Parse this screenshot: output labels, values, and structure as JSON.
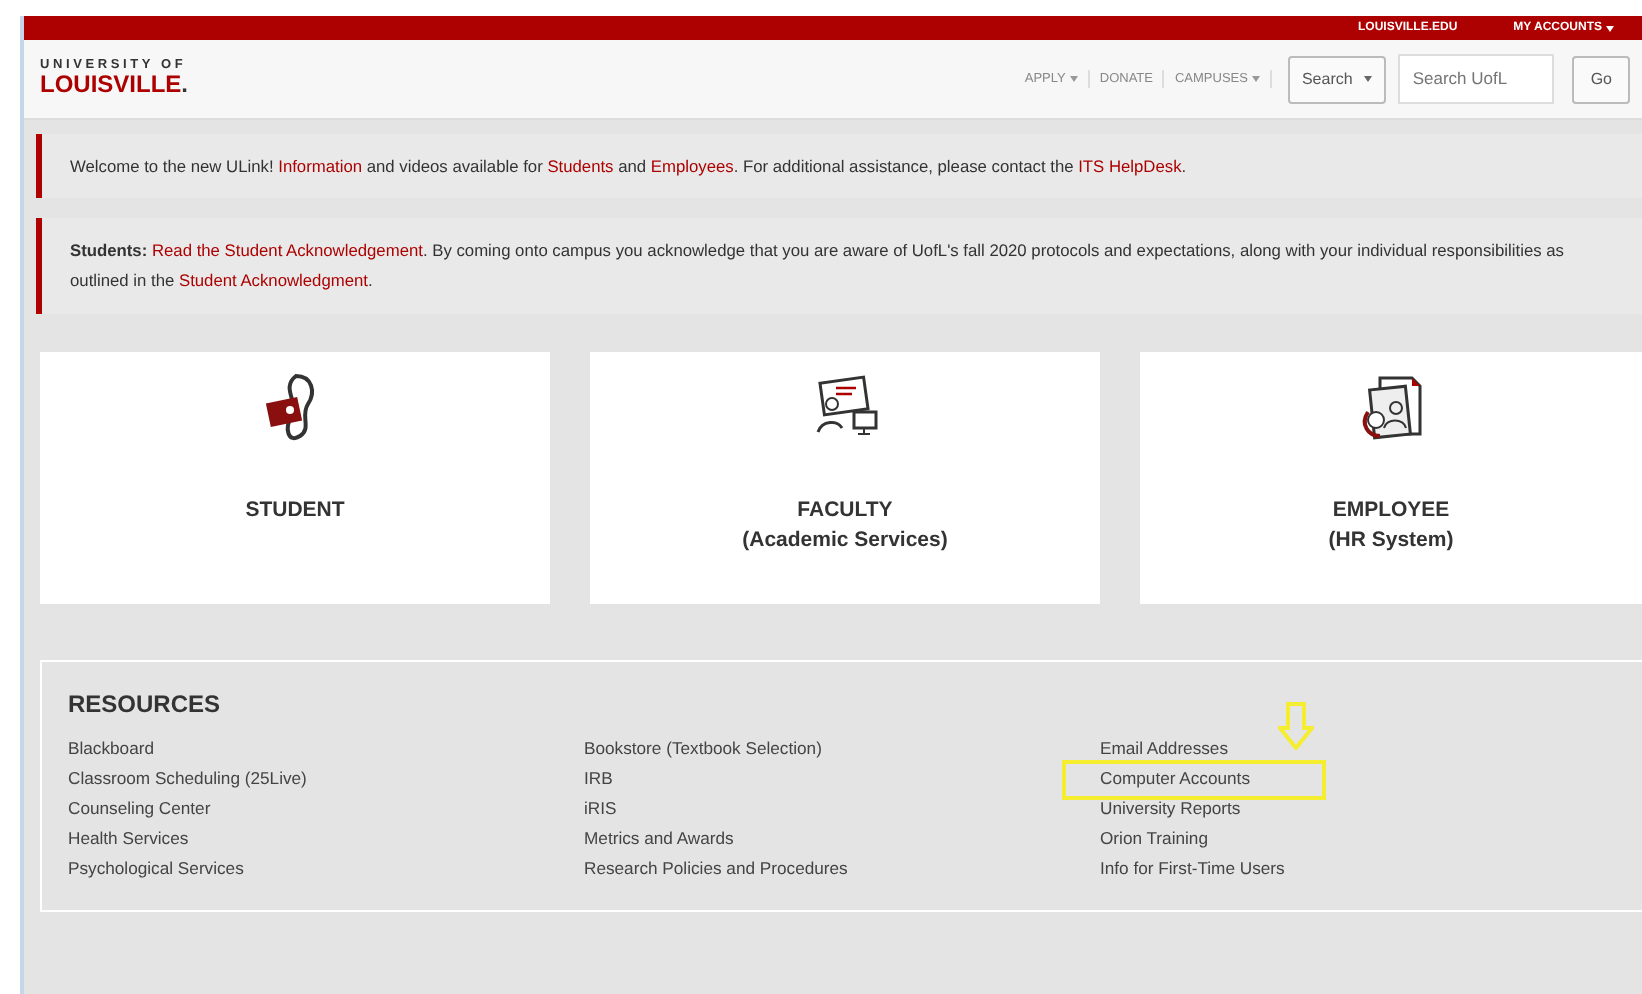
{
  "top_bar": {
    "links": [
      {
        "label": "LOUISVILLE.EDU",
        "caret": false
      },
      {
        "label": "MY ACCOUNTS",
        "caret": true
      }
    ]
  },
  "header": {
    "logo_top": "UNIVERSITY OF",
    "logo_main": "LOUISVILLE",
    "logo_dot": ".",
    "nav": [
      {
        "label": "APPLY",
        "caret": true
      },
      {
        "label": "DONATE",
        "caret": false
      },
      {
        "label": "CAMPUSES",
        "caret": true
      }
    ],
    "search_scope": "Search",
    "search_placeholder": "Search UofL",
    "go_button": "Go"
  },
  "alerts": [
    {
      "parts": [
        {
          "kind": "text",
          "text": "Welcome to the new ULink! "
        },
        {
          "kind": "link",
          "text": "Information"
        },
        {
          "kind": "text",
          "text": " and videos available for "
        },
        {
          "kind": "link",
          "text": "Students"
        },
        {
          "kind": "text",
          "text": " and "
        },
        {
          "kind": "link",
          "text": "Employees"
        },
        {
          "kind": "text",
          "text": ". For additional assistance, please contact the "
        },
        {
          "kind": "link",
          "text": "ITS HelpDesk"
        },
        {
          "kind": "text",
          "text": "."
        }
      ]
    },
    {
      "parts": [
        {
          "kind": "bold",
          "text": "Students:"
        },
        {
          "kind": "link",
          "text": "Read the Student Acknowledgement"
        },
        {
          "kind": "text",
          "text": ". By coming onto campus you acknowledge that you are aware of UofL's fall 2020 protocols and expectations, along with your individual responsibilities as outlined in the "
        },
        {
          "kind": "link",
          "text": "Student Acknowledgment"
        },
        {
          "kind": "text",
          "text": "."
        }
      ]
    }
  ],
  "tiles": [
    {
      "kind": "student",
      "title": "STUDENT"
    },
    {
      "kind": "faculty",
      "title": "FACULTY",
      "subtitle": "(Academic Services)"
    },
    {
      "kind": "employee",
      "title": "EMPLOYEE",
      "subtitle": "(HR System)"
    }
  ],
  "resources": {
    "title": "RESOURCES",
    "columns": [
      [
        {
          "label": "Blackboard",
          "highlighted": false
        },
        {
          "label": "Classroom Scheduling (25Live)",
          "highlighted": false
        },
        {
          "label": "Counseling Center",
          "highlighted": false
        },
        {
          "label": "Health Services",
          "highlighted": false
        },
        {
          "label": "Psychological Services",
          "highlighted": false
        }
      ],
      [
        {
          "label": "Bookstore (Textbook Selection)",
          "highlighted": false
        },
        {
          "label": "IRB",
          "highlighted": false
        },
        {
          "label": "iRIS",
          "highlighted": false
        },
        {
          "label": "Metrics and Awards",
          "highlighted": false
        },
        {
          "label": "Research Policies and Procedures",
          "highlighted": false
        }
      ],
      [
        {
          "label": "Email Addresses",
          "highlighted": false
        },
        {
          "label": "Computer Accounts",
          "highlighted": true
        },
        {
          "label": "University Reports",
          "highlighted": false
        },
        {
          "label": "Orion Training",
          "highlighted": false
        },
        {
          "label": "Info for First-Time Users",
          "highlighted": false
        }
      ]
    ]
  }
}
